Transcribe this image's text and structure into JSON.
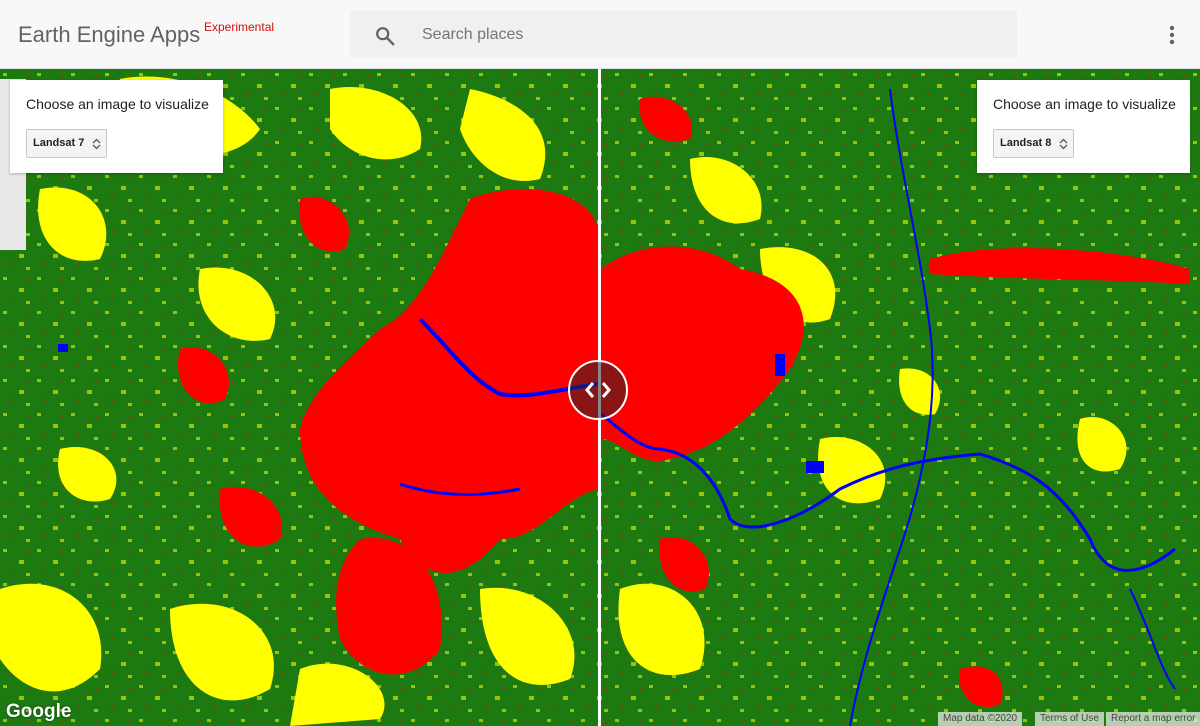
{
  "app": {
    "title": "Earth Engine Apps",
    "badge": "Experimental"
  },
  "search": {
    "placeholder": "Search places",
    "value": ""
  },
  "icons": {
    "search": "search-icon",
    "more": "more-vert-icon",
    "split": "chevron-left-right-icon",
    "select_arrows": "up-down-arrows-icon"
  },
  "left_panel": {
    "title": "Choose an image to visualize",
    "selected": "Landsat 7"
  },
  "right_panel": {
    "title": "Choose an image to visualize",
    "selected": "Landsat 8"
  },
  "map": {
    "legend_colors": {
      "vegetation": "#1d7a10",
      "urban": "#ff0000",
      "bare": "#ffff00",
      "water": "#0000ff"
    },
    "logo": "Google",
    "attribution": {
      "data": "Map data ©2020",
      "terms": "Terms of Use",
      "report": "Report a map error"
    }
  }
}
